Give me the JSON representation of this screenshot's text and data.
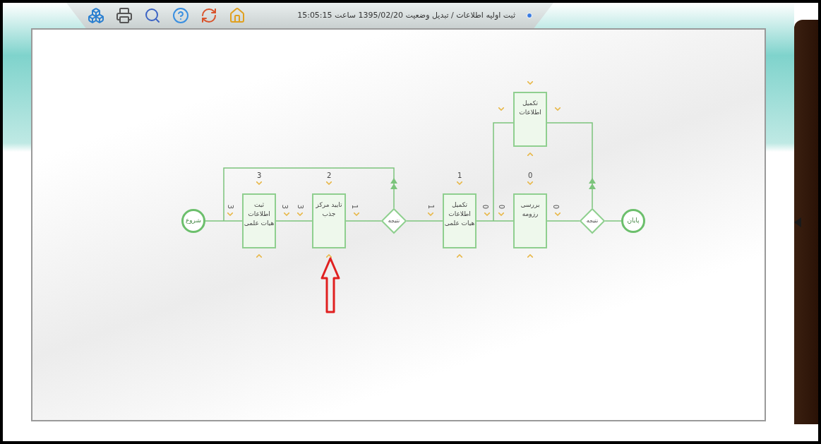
{
  "header": {
    "title": "ثبت اولیه اطلاعات / تبدیل وضعیت  1395/02/20 ساعت 15:05:15"
  },
  "diagram": {
    "nodes": [
      {
        "kind": "task",
        "label": "تکمیل اطلاعات"
      },
      {
        "kind": "end",
        "label": "پایان"
      },
      {
        "kind": "decision",
        "label": "نتیجه"
      },
      {
        "kind": "task",
        "label": "بررسی رزومه",
        "count": "0",
        "in": "0",
        "out": "0"
      },
      {
        "kind": "task",
        "label": "تکمیل اطلاعات هیات علمی",
        "count": "1",
        "in": "1",
        "out": "0"
      },
      {
        "kind": "decision",
        "label": "نتیجه"
      },
      {
        "kind": "task",
        "label": "تایید مرکز جذب",
        "count": "2",
        "in": "3",
        "out": "1"
      },
      {
        "kind": "task",
        "label": "ثبت اطلاعات هیات علمی",
        "count": "3",
        "in": "3",
        "out": "3"
      },
      {
        "kind": "start",
        "label": "شروع"
      }
    ]
  }
}
